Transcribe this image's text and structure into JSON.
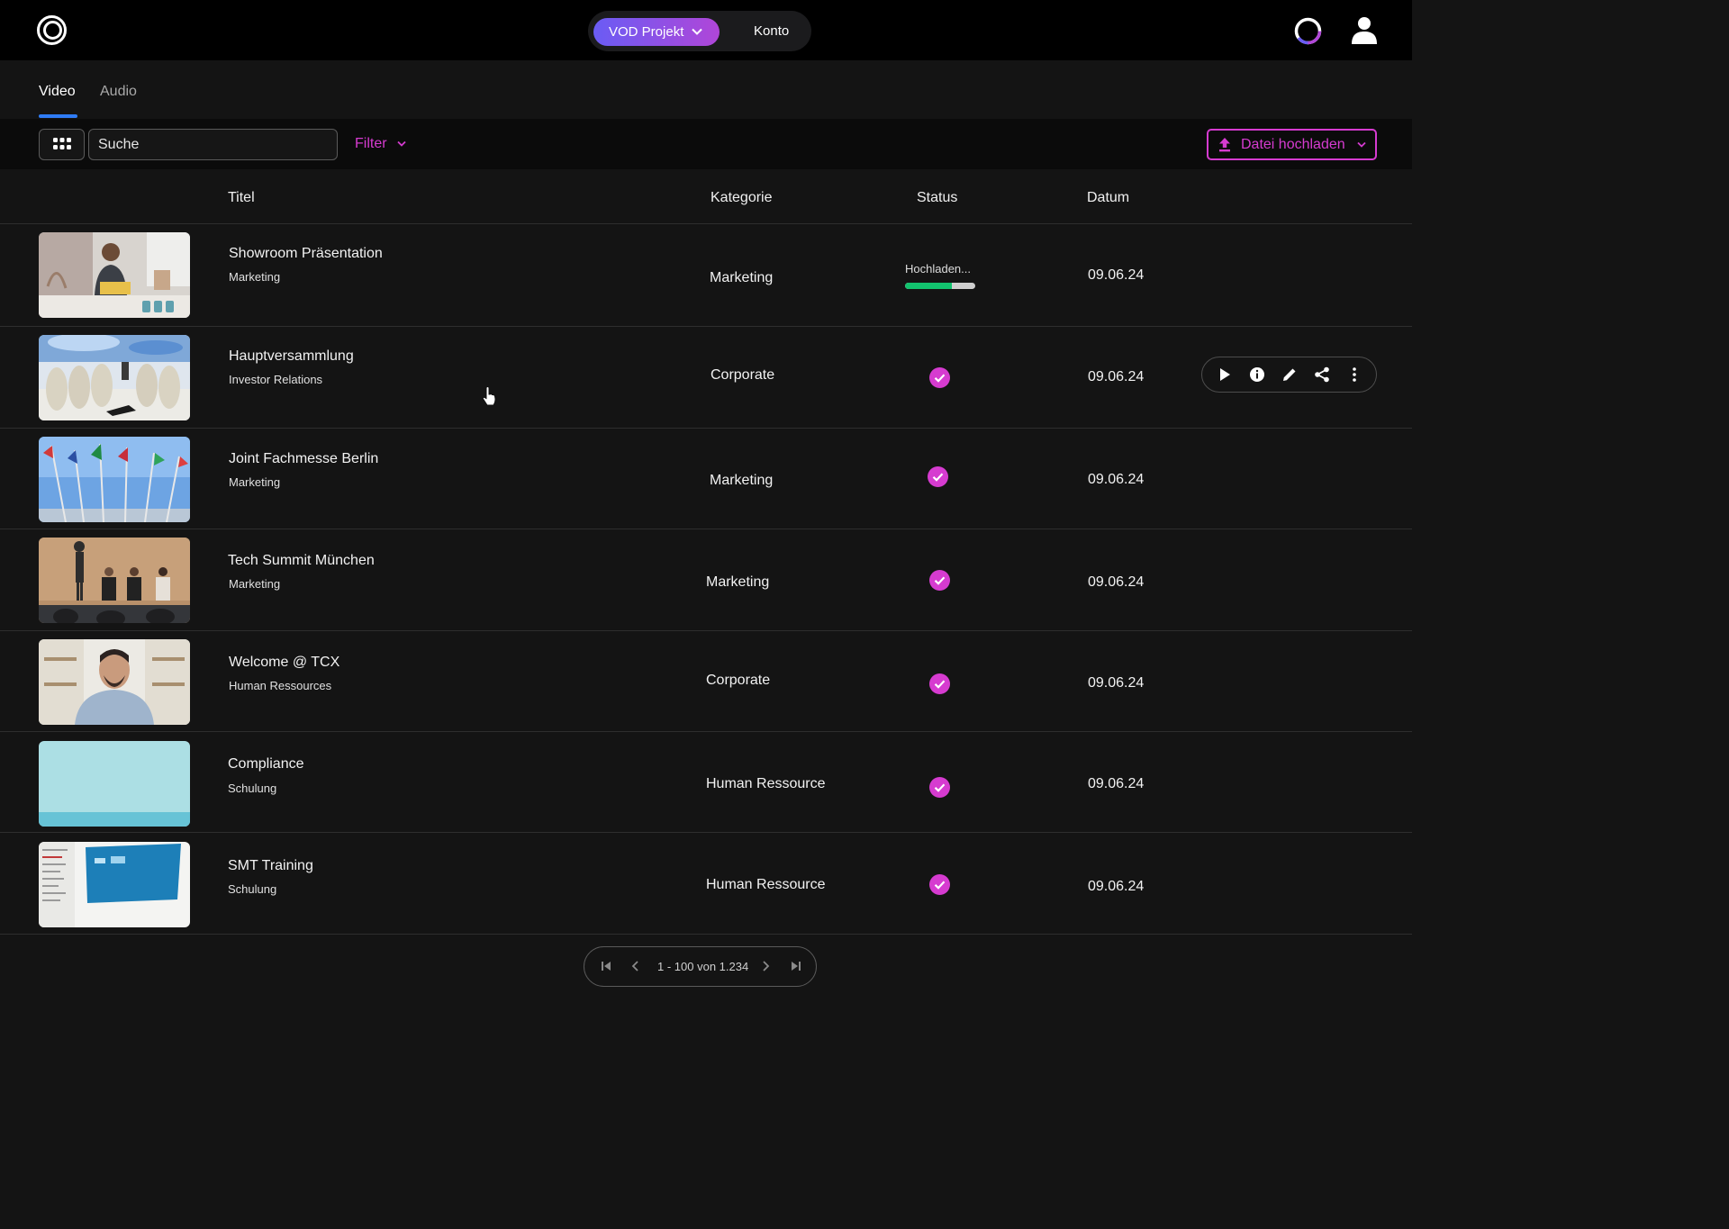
{
  "header": {
    "project_label": "VOD Projekt",
    "account_label": "Konto",
    "progress_ring": 0.3
  },
  "tabs": [
    {
      "label": "Video",
      "active": true
    },
    {
      "label": "Audio",
      "active": false
    }
  ],
  "toolbar": {
    "search_placeholder": "Suche",
    "filter_label": "Filter",
    "upload_label": "Datei hochladen"
  },
  "columns": {
    "title": "Titel",
    "category": "Kategorie",
    "status": "Status",
    "date": "Datum"
  },
  "rows": [
    {
      "title": "Showroom Präsentation",
      "subtitle": "Marketing",
      "category": "Marketing",
      "status": "uploading",
      "status_text": "Hochladen...",
      "progress": 0.67,
      "date": "09.06.24"
    },
    {
      "title": "Hauptversammlung",
      "subtitle": "Investor Relations",
      "category": "Corporate",
      "status": "ready",
      "date": "09.06.24",
      "hover": true
    },
    {
      "title": "Joint Fachmesse Berlin",
      "subtitle": "Marketing",
      "category": "Marketing",
      "status": "ready",
      "date": "09.06.24"
    },
    {
      "title": "Tech Summit München",
      "subtitle": "Marketing",
      "category": "Marketing",
      "status": "ready",
      "date": "09.06.24"
    },
    {
      "title": "Welcome @ TCX",
      "subtitle": "Human Ressources",
      "category": "Corporate",
      "status": "ready",
      "date": "09.06.24"
    },
    {
      "title": "Compliance",
      "subtitle": "Schulung",
      "category": "Human Ressource",
      "status": "ready",
      "date": "09.06.24"
    },
    {
      "title": "SMT Training",
      "subtitle": "Schulung",
      "category": "Human Ressource",
      "status": "ready",
      "date": "09.06.24"
    }
  ],
  "row_actions": [
    "play-icon",
    "info-icon",
    "edit-icon",
    "share-icon",
    "more-icon"
  ],
  "pagination": {
    "label": "1 - 100 von 1.234"
  },
  "colors": {
    "accent": "#d63bd0",
    "tab_indicator": "#2f7cf6",
    "progress": "#12c26e",
    "gradient_start": "#6a5cf4",
    "gradient_end": "#b046d8"
  }
}
